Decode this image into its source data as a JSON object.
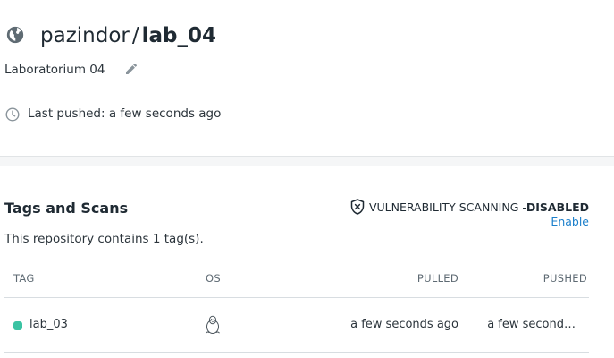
{
  "repo": {
    "namespace": "pazindor",
    "separator": "/",
    "name": "lab_04",
    "description": "Laboratorium 04",
    "last_pushed": "Last pushed: a few seconds ago"
  },
  "tags_section": {
    "title": "Tags and Scans",
    "summary": "This repository contains 1 tag(s).",
    "vulnerability_label": "VULNERABILITY SCANNING - ",
    "vulnerability_status": "DISABLED",
    "enable_link": "Enable",
    "columns": {
      "tag": "TAG",
      "os": "OS",
      "pulled": "PULLED",
      "pushed": "PUSHED"
    },
    "rows": [
      {
        "tag": "lab_03",
        "os": "linux-icon",
        "pulled": "a few seconds ago",
        "pushed": "a few second…"
      }
    ]
  },
  "colors": {
    "accent_link": "#1b7fcb",
    "tag_dot": "#3bc3a3",
    "text": "#1f2a33"
  }
}
